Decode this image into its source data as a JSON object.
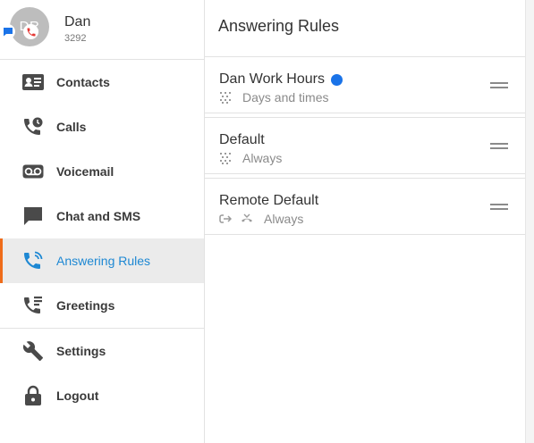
{
  "profile": {
    "initials": "DR",
    "name": "Dan",
    "extension": "3292",
    "badge_chat_color": "#1a73e8",
    "badge_phone_color": "#e53935"
  },
  "sidebar": {
    "items": [
      {
        "label": "Contacts",
        "icon": "contacts-card-icon"
      },
      {
        "label": "Calls",
        "icon": "phone-clock-icon"
      },
      {
        "label": "Voicemail",
        "icon": "voicemail-icon"
      },
      {
        "label": "Chat and SMS",
        "icon": "chat-bubble-icon"
      },
      {
        "label": "Answering Rules",
        "icon": "phone-forward-icon",
        "active": true
      },
      {
        "label": "Greetings",
        "icon": "phone-greeting-icon"
      },
      {
        "label": "Settings",
        "icon": "wrench-icon"
      },
      {
        "label": "Logout",
        "icon": "lock-icon"
      }
    ],
    "active_color": "#1e88d3",
    "active_border_color": "#ef6c1a"
  },
  "main": {
    "title": "Answering Rules",
    "rules": [
      {
        "name": "Dan Work Hours",
        "subtitle": "Days and times",
        "active_dot": true,
        "icons": [
          "schedule-grid-icon"
        ]
      },
      {
        "name": "Default",
        "subtitle": "Always",
        "active_dot": false,
        "icons": [
          "schedule-grid-icon"
        ]
      },
      {
        "name": "Remote Default",
        "subtitle": "Always",
        "active_dot": false,
        "icons": [
          "forward-arrow-icon",
          "hangup-icon"
        ]
      }
    ]
  }
}
